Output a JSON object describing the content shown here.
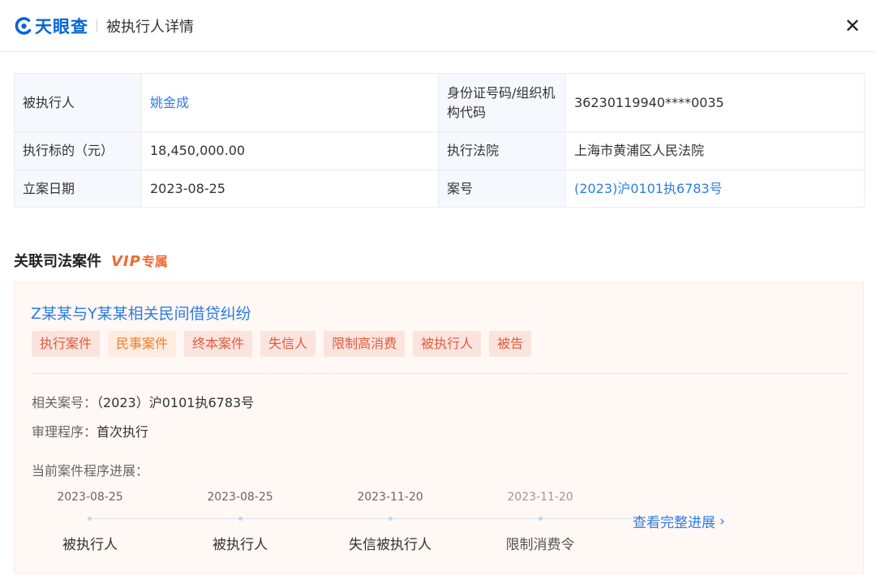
{
  "header": {
    "logo_text": "天眼查",
    "title": "被执行人详情",
    "close_icon": "close-icon",
    "brand_color": "#0a64d6"
  },
  "info": {
    "row1": {
      "k1": "被执行人",
      "v1": "姚金成",
      "k2": "身份证号码/组织机构代码",
      "v2": "36230119940****0035"
    },
    "row2": {
      "k1": "执行标的（元）",
      "v1": "18,450,000.00",
      "k2": "执行法院",
      "v2": "上海市黄浦区人民法院"
    },
    "row3": {
      "k1": "立案日期",
      "v1": "2023-08-25",
      "k2": "案号",
      "v2": "(2023)沪0101执6783号"
    }
  },
  "section": {
    "title": "关联司法案件",
    "vip": "VIP",
    "vip_suffix": "专属",
    "vip_color": "#f06a2f"
  },
  "case": {
    "title": "Z某某与Y某某相关民间借贷纠纷",
    "tags": [
      {
        "label": "执行案件",
        "color": "red"
      },
      {
        "label": "民事案件",
        "color": "orange"
      },
      {
        "label": "终本案件",
        "color": "red"
      },
      {
        "label": "失信人",
        "color": "red"
      },
      {
        "label": "限制高消费",
        "color": "red"
      },
      {
        "label": "被执行人",
        "color": "red"
      },
      {
        "label": "被告",
        "color": "red"
      }
    ],
    "case_no_label": "相关案号：",
    "case_no": "（2023）沪0101执6783号",
    "procedure_label": "审理程序：",
    "procedure": "首次执行",
    "progress_label": "当前案件程序进展：",
    "timeline": [
      {
        "date": "2023-08-25",
        "label": "被执行人"
      },
      {
        "date": "2023-08-25",
        "label": "被执行人"
      },
      {
        "date": "2023-11-20",
        "label": "失信被执行人"
      },
      {
        "date": "2023-11-20",
        "label": "限制消费令"
      }
    ],
    "view_all": "查看完整进展",
    "view_all_icon": "chevron-right-icon"
  }
}
